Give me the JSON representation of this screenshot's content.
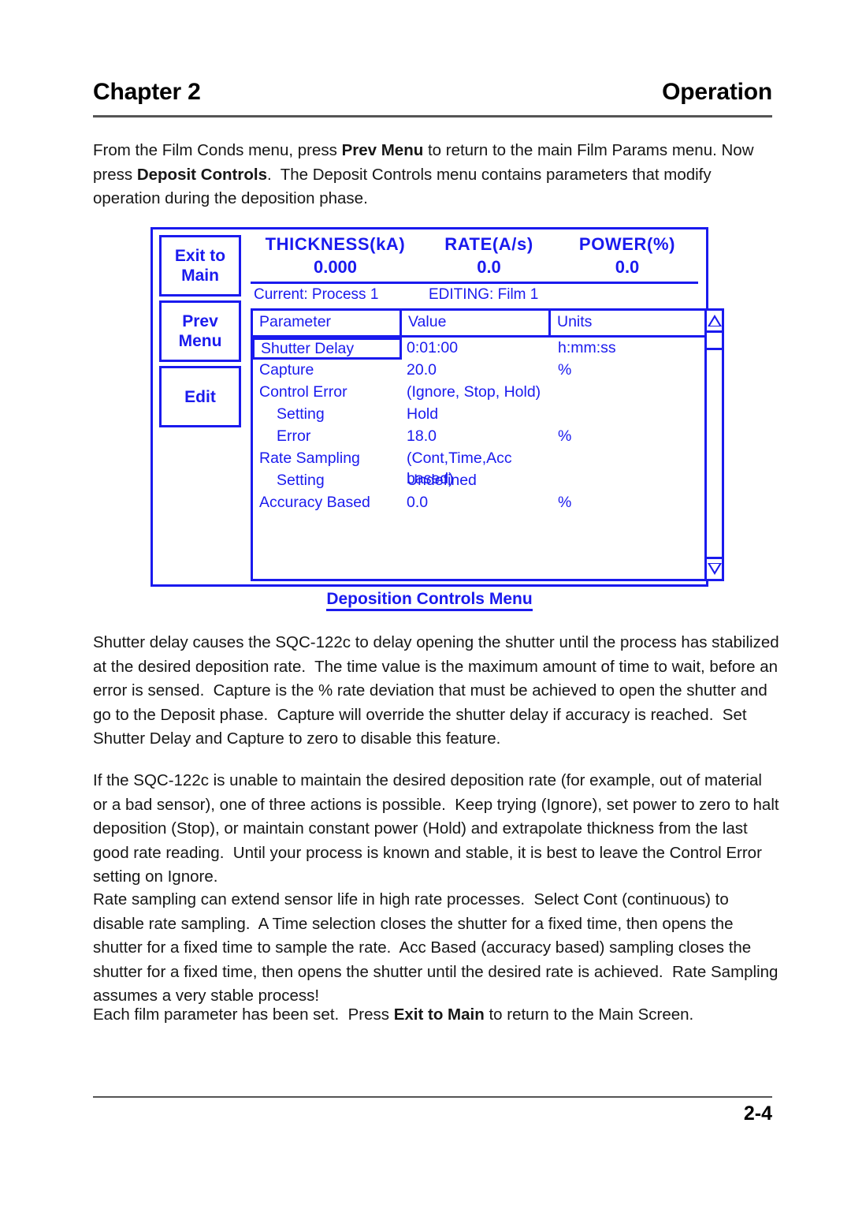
{
  "header": {
    "chapter": "Chapter 2",
    "section": "Operation"
  },
  "paragraphs": {
    "intro_a": "From the Film Conds menu, press ",
    "intro_b": "Prev Menu",
    "intro_c": " to return to the main Film Params menu. Now press ",
    "intro_d": "Deposit Controls",
    "intro_e": ".  The Deposit Controls menu contains parameters that modify operation during the deposition phase.",
    "p2": "Shutter delay causes the SQC-122c to delay opening the shutter until the process has stabilized at the desired deposition rate.  The time value is the maximum amount of time to wait, before an error is sensed.  Capture is the % rate deviation that must be achieved to open the shutter and go to the Deposit phase.  Capture will override the shutter delay if accuracy is reached.  Set Shutter Delay and Capture to zero to disable this feature.",
    "p3": "If the SQC-122c is unable to maintain the desired deposition rate (for example, out of material or a bad sensor), one of three actions is possible.  Keep trying (Ignore), set power to zero to halt deposition (Stop), or maintain constant power (Hold) and extrapolate thickness from the last good rate reading.  Until your process is known and stable, it is best to leave the Control Error setting on Ignore.",
    "p4": "Rate sampling can extend sensor life in high rate processes.  Select Cont (continuous) to disable rate sampling.  A Time selection closes the shutter for a fixed time, then opens the shutter for a fixed time to sample the rate.  Acc Based (accuracy based) sampling closes the shutter for a fixed time, then opens the shutter until the desired rate is achieved.  Rate Sampling assumes a very stable process!",
    "p5_a": "Each film parameter has been set.  Press ",
    "p5_b": "Exit to Main",
    "p5_c": " to return to the Main Screen."
  },
  "figure": {
    "caption": "Deposition Controls Menu",
    "accent_color": "#1a1aee",
    "softkeys": [
      {
        "line1": "Exit to",
        "line2": "Main"
      },
      {
        "line1": "Prev",
        "line2": "Menu"
      },
      {
        "line1": "Edit",
        "line2": ""
      }
    ],
    "readouts": [
      {
        "label": "THICKNESS(kA)",
        "value": "0.000"
      },
      {
        "label": "RATE(A/s)",
        "value": "0.0"
      },
      {
        "label": "POWER(%)",
        "value": "0.0"
      }
    ],
    "status": {
      "current": "Current: Process 1",
      "editing": "EDITING:  Film 1"
    },
    "table": {
      "columns": [
        "Parameter",
        "Value",
        "Units"
      ],
      "rows": [
        {
          "parameter": "Shutter Delay",
          "value": "0:01:00",
          "units": "h:mm:ss",
          "indent": false,
          "selected": true
        },
        {
          "parameter": "Capture",
          "value": "20.0",
          "units": "%",
          "indent": false,
          "selected": false
        },
        {
          "parameter": "Control Error",
          "value": "(Ignore, Stop, Hold)",
          "units": "",
          "indent": false,
          "selected": false
        },
        {
          "parameter": "Setting",
          "value": "Hold",
          "units": "",
          "indent": true,
          "selected": false
        },
        {
          "parameter": "Error",
          "value": "18.0",
          "units": "%",
          "indent": true,
          "selected": false
        },
        {
          "parameter": "Rate Sampling",
          "value": "(Cont,Time,Acc based)",
          "units": "",
          "indent": false,
          "selected": false
        },
        {
          "parameter": "Setting",
          "value": "Undefined",
          "units": "",
          "indent": true,
          "selected": false
        },
        {
          "parameter": "Accuracy Based",
          "value": "0.0",
          "units": "%",
          "indent": false,
          "selected": false
        }
      ]
    },
    "scrollbar": {
      "up_icon": "triangle-up-icon",
      "down_icon": "triangle-down-icon"
    }
  },
  "footer": {
    "page_number": "2-4"
  }
}
